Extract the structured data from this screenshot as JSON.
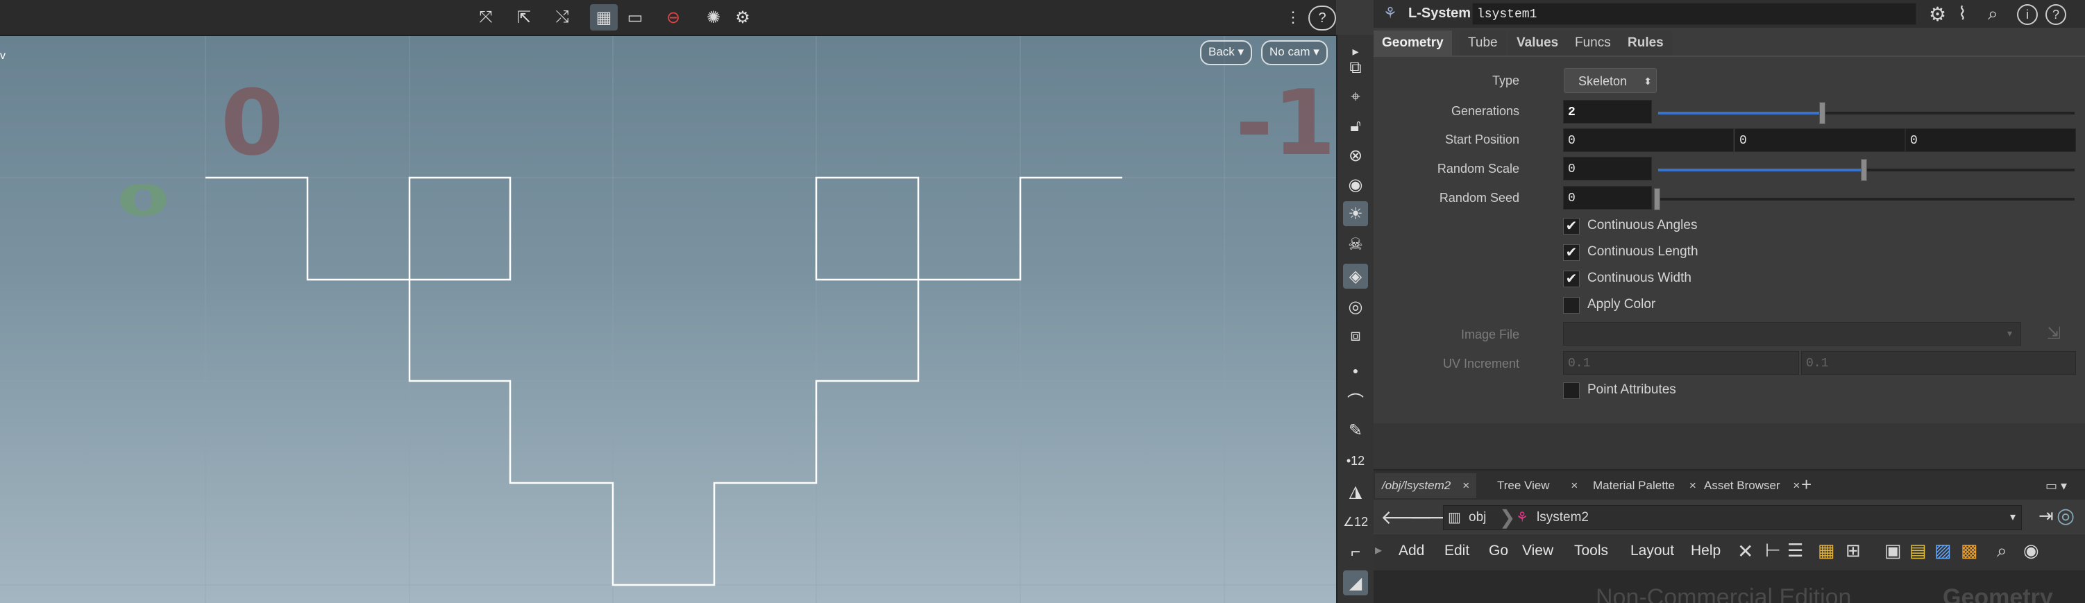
{
  "viewport": {
    "toolbar_icons": [
      "select-transform-icon",
      "handle-icon",
      "pose-icon",
      "display-options-icon",
      "view-icon",
      "stop-icon",
      "snapshot-icon",
      "settings-icon"
    ],
    "right_icons": [
      "layout-icon",
      "help-icon"
    ],
    "back_label": "Back",
    "cam_label": "No cam",
    "corner_text": "v",
    "num_zero_red": "0",
    "num_neg_one": "-1",
    "num_zero_green": "0",
    "colors": {
      "red": "#7a5a60",
      "green": "#6f9a77",
      "line": "#ffffff"
    }
  },
  "shelf_icons": [
    "toggle-icon",
    "snap-icon",
    "lock-icon",
    "close-icon",
    "sphere-icon",
    "light-icon",
    "ghost-icon",
    "render-icon",
    "eye-icon",
    "camera-icon",
    "dot-icon",
    "brush-icon",
    "pen-icon",
    "number-icon",
    "paint-icon",
    "angle-icon",
    "measure-icon",
    "shape-icon"
  ],
  "params": {
    "node_type": "L-System",
    "node_name": "lsystem1",
    "header_icons": [
      "gear-icon",
      "brush-icon",
      "search-icon",
      "info-icon",
      "help-icon"
    ],
    "tabs": [
      "Geometry",
      "Tube",
      "Values",
      "Funcs",
      "Rules"
    ],
    "type_label": "Type",
    "type_value": "Skeleton",
    "generations_label": "Generations",
    "generations_value": "2",
    "start_position_label": "Start Position",
    "start_position": [
      "0",
      "0",
      "0"
    ],
    "random_scale_label": "Random Scale",
    "random_scale_value": "0",
    "random_seed_label": "Random Seed",
    "random_seed_value": "0",
    "checks": [
      {
        "label": "Continuous Angles",
        "checked": true
      },
      {
        "label": "Continuous Length",
        "checked": true
      },
      {
        "label": "Continuous Width",
        "checked": true
      },
      {
        "label": "Apply Color",
        "checked": false
      }
    ],
    "image_file_label": "Image File",
    "uv_increment_label": "UV Increment",
    "uv_increment": [
      "0.1",
      "0.1"
    ],
    "point_attributes_label": "Point Attributes"
  },
  "network": {
    "tabs": [
      "/obj/lsystem2",
      "Tree View",
      "Material Palette",
      "Asset Browser"
    ],
    "path_obj": "obj",
    "path_node": "lsystem2",
    "menu": [
      "Add",
      "Edit",
      "Go",
      "View",
      "Tools",
      "Layout",
      "Help"
    ],
    "watermark": "Non-Commercial Edition",
    "context_label": "Geometry"
  }
}
